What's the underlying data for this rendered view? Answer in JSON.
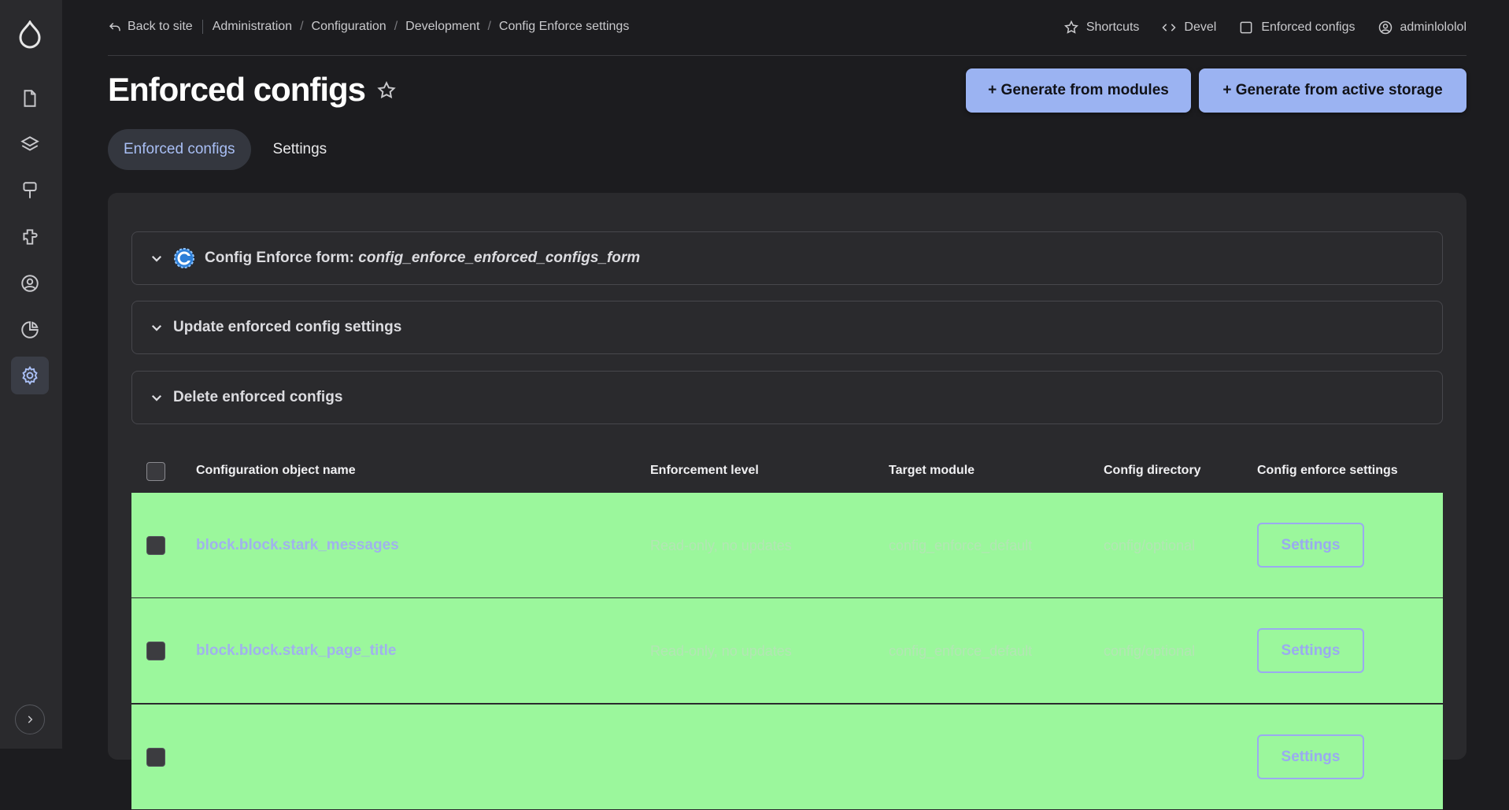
{
  "breadcrumb": {
    "back": "Back to site",
    "items": [
      "Administration",
      "Configuration",
      "Development",
      "Config Enforce settings"
    ]
  },
  "topnav": {
    "shortcuts": "Shortcuts",
    "devel": "Devel",
    "enforced": "Enforced configs",
    "user": "adminlololol"
  },
  "page": {
    "title": "Enforced configs",
    "btn_modules": "+ Generate from modules",
    "btn_active": "+ Generate from active storage"
  },
  "tabs": [
    {
      "label": "Enforced configs",
      "active": true
    },
    {
      "label": "Settings",
      "active": false
    }
  ],
  "accordions": {
    "form_label": "Config Enforce form: ",
    "form_id": "config_enforce_enforced_configs_form",
    "update": "Update enforced config settings",
    "delete": "Delete enforced configs"
  },
  "table": {
    "headers": [
      "Configuration object name",
      "Enforcement level",
      "Target module",
      "Config directory",
      "Config enforce settings"
    ],
    "rows": [
      {
        "name": "block.block.stark_messages",
        "level": "Read-only, no updates",
        "module": "config_enforce_default",
        "dir": "config/optional",
        "action": "Settings"
      },
      {
        "name": "block.block.stark_page_title",
        "level": "Read-only, no updates",
        "module": "config_enforce_default",
        "dir": "config/optional",
        "action": "Settings"
      },
      {
        "name": "",
        "level": "",
        "module": "",
        "dir": "",
        "action": "Settings"
      }
    ]
  },
  "colors": {
    "accent": "#9bb3f2",
    "row_bg": "#9bf79c",
    "link": "#a0b2ec"
  }
}
